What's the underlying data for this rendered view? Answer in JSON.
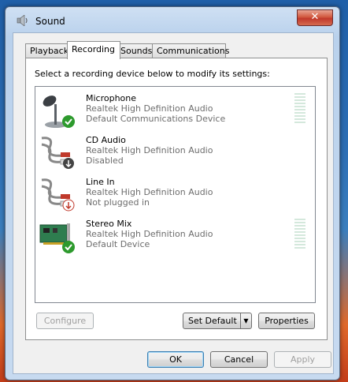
{
  "window": {
    "title": "Sound",
    "close_label": "✕"
  },
  "tabs": [
    {
      "label": "Playback"
    },
    {
      "label": "Recording"
    },
    {
      "label": "Sounds"
    },
    {
      "label": "Communications"
    }
  ],
  "active_tab": "Recording",
  "instructions": "Select a recording device below to modify its settings:",
  "devices": [
    {
      "name": "Microphone",
      "driver": "Realtek High Definition Audio",
      "status": "Default Communications Device",
      "icon": "microphone-icon",
      "badge": "phone-check-badge-icon",
      "badge_color": "#2d9a2d",
      "level_meter": true
    },
    {
      "name": "CD Audio",
      "driver": "Realtek High Definition Audio",
      "status": "Disabled",
      "icon": "rca-cable-icon",
      "badge": "disabled-arrow-badge-icon",
      "badge_color": "#444444",
      "level_meter": false
    },
    {
      "name": "Line In",
      "driver": "Realtek High Definition Audio",
      "status": "Not plugged in",
      "icon": "rca-cable-icon",
      "badge": "unplugged-badge-icon",
      "badge_color": "#c0392b",
      "level_meter": false
    },
    {
      "name": "Stereo Mix",
      "driver": "Realtek High Definition Audio",
      "status": "Default Device",
      "icon": "sound-card-icon",
      "badge": "check-badge-icon",
      "badge_color": "#2d9a2d",
      "level_meter": true
    }
  ],
  "buttons": {
    "configure": "Configure",
    "set_default": "Set Default",
    "set_default_arrow": "▼",
    "properties": "Properties",
    "ok": "OK",
    "cancel": "Cancel",
    "apply": "Apply"
  },
  "colors": {
    "meter_segment": "#d4e8dc",
    "title_bar": "#b9d1ec",
    "close_button": "#c1392b"
  }
}
